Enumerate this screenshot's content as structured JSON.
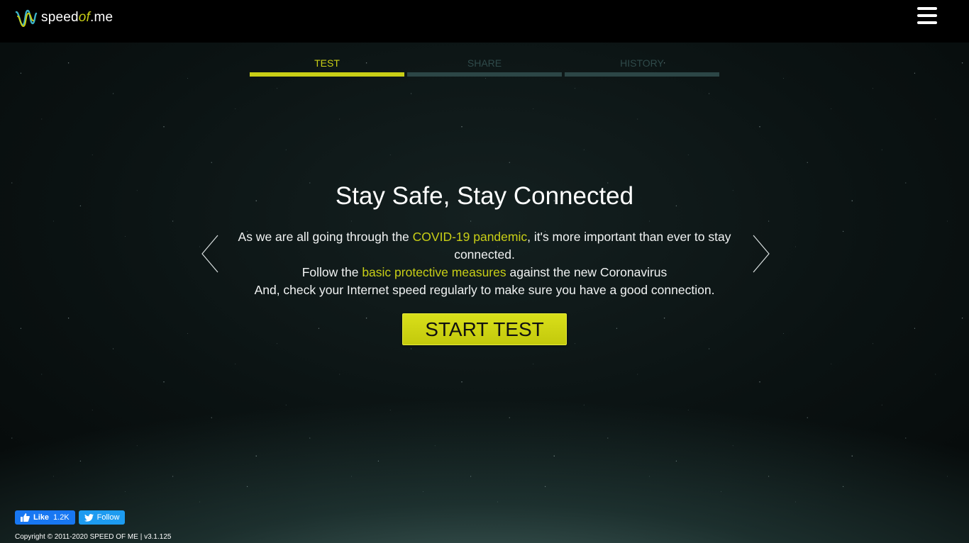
{
  "header": {
    "logo_prefix": "speed",
    "logo_accent": "of",
    "logo_suffix": ".me",
    "menu_icon": "hamburger-menu-icon"
  },
  "tabs": [
    {
      "label": "TEST",
      "active": true
    },
    {
      "label": "SHARE",
      "active": false
    },
    {
      "label": "HISTORY",
      "active": false
    }
  ],
  "main": {
    "title": "Stay Safe, Stay Connected",
    "line1_pre": "As we are all going through the ",
    "line1_link": "COVID-19 pandemic",
    "line1_post": ", it's more important than ever to stay connected.",
    "line2_pre": "Follow the ",
    "line2_link": "basic protective measures",
    "line2_post": " against the new Coronavirus",
    "line3": "And, check your Internet speed regularly to make sure you have a good connection.",
    "start_button": "START TEST"
  },
  "carousel": {
    "prev_icon": "chevron-left-icon",
    "next_icon": "chevron-right-icon"
  },
  "social": {
    "like_label": "Like",
    "like_count": "1.2K",
    "follow_label": "Follow"
  },
  "footer": {
    "copyright": "Copyright © 2011-2020 SPEED OF ME | v3.1.125"
  },
  "colors": {
    "accent": "#c9cf16",
    "tab_inactive": "#2c4646",
    "facebook": "#1877f2",
    "twitter": "#1d9bf0"
  }
}
